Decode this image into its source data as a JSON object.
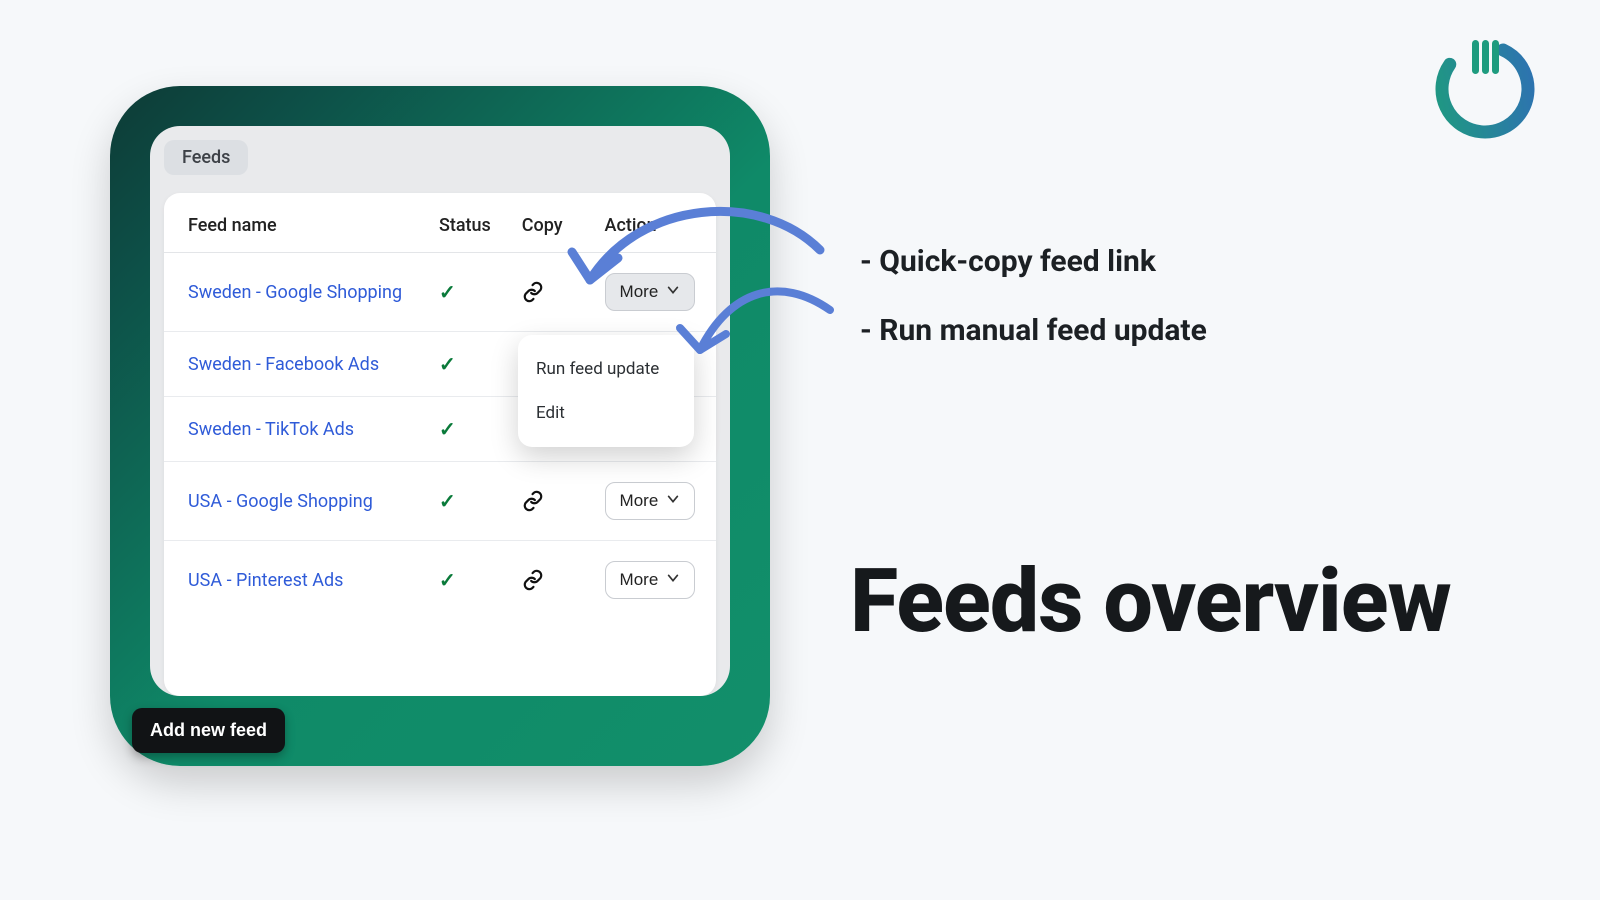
{
  "brand": {
    "color_a": "#1e9b7e",
    "color_b": "#2f6fb5"
  },
  "app": {
    "chip_label": "Feeds",
    "columns": {
      "name": "Feed name",
      "status": "Status",
      "copy": "Copy",
      "action": "Action"
    },
    "more_label": "More",
    "add_button": "Add new feed",
    "dropdown": {
      "run": "Run feed update",
      "edit": "Edit"
    },
    "feeds": [
      {
        "name": "Sweden - Google Shopping",
        "status_ok": true,
        "show_copy": true,
        "more_hovered": true
      },
      {
        "name": "Sweden - Facebook Ads",
        "status_ok": true,
        "show_copy": false
      },
      {
        "name": "Sweden - TikTok Ads",
        "status_ok": true,
        "show_copy": false
      },
      {
        "name": "USA - Google Shopping",
        "status_ok": true,
        "show_copy": true
      },
      {
        "name": "USA - Pinterest Ads",
        "status_ok": true,
        "show_copy": true
      }
    ]
  },
  "notes": {
    "a": "- Quick-copy feed link",
    "b": "- Run manual feed update"
  },
  "headline": "Feeds overview"
}
